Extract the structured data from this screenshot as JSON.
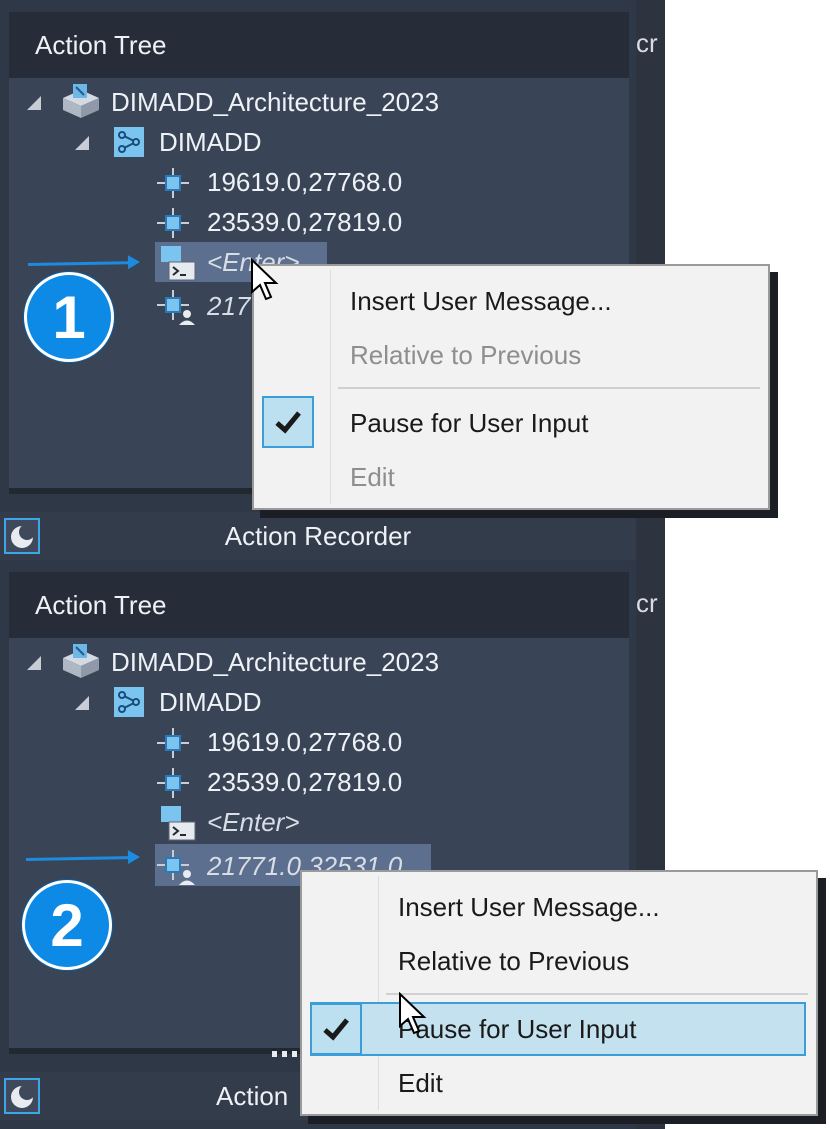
{
  "panels": [
    {
      "header": "Action Tree",
      "tree": {
        "root": "DIMADD_Architecture_2023",
        "command": "DIMADD",
        "point1": "19619.0,27768.0",
        "point2": "23539.0,27819.0",
        "enter": "<Enter>",
        "point3": "217"
      },
      "footer": "Action Recorder",
      "badge": "1",
      "bg_text": "cr",
      "menu": {
        "insert_message": "Insert User Message...",
        "relative": "Relative to Previous",
        "pause": "Pause for User Input",
        "edit": "Edit",
        "pause_checked": true
      }
    },
    {
      "header": "Action Tree",
      "tree": {
        "root": "DIMADD_Architecture_2023",
        "command": "DIMADD",
        "point1": "19619.0,27768.0",
        "point2": "23539.0,27819.0",
        "enter": "<Enter>",
        "point3": "21771.0,32531.0"
      },
      "footer": "Action",
      "badge": "2",
      "bg_text": "cr",
      "menu": {
        "insert_message": "Insert User Message...",
        "relative": "Relative to Previous",
        "pause": "Pause for User Input",
        "edit": "Edit",
        "pause_checked": true
      }
    }
  ],
  "colors": {
    "accent": "#0d8ae6",
    "panel_bg": "#394556",
    "header_bg": "#262d38",
    "selection": "#5d6f8e",
    "menu_bg": "#f2f2f2",
    "menu_highlight": "#c3e1ef"
  }
}
